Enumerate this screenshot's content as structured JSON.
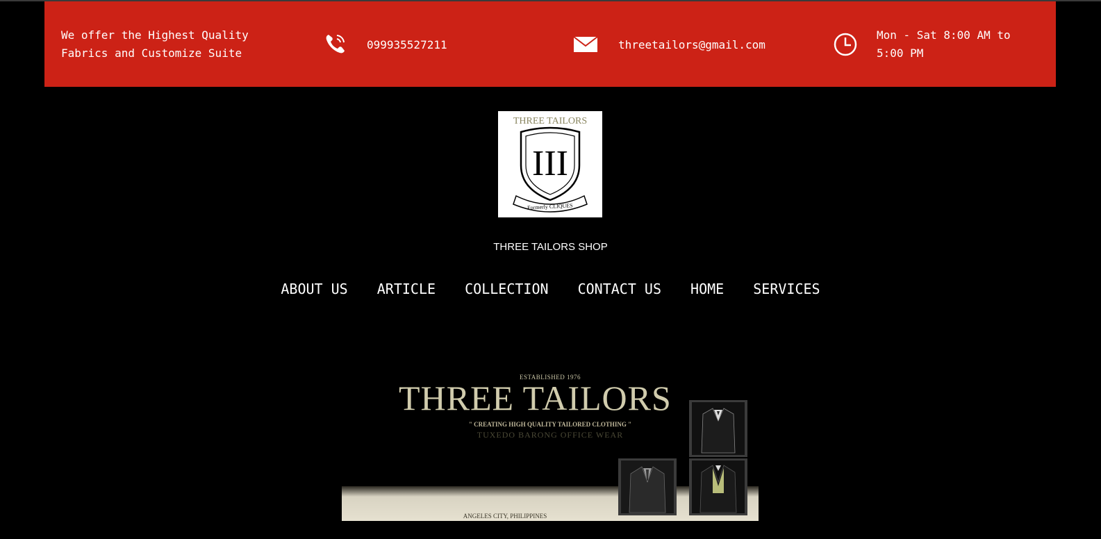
{
  "topbar": {
    "tagline": "We offer the Highest Quality Fabrics and Customize Suite",
    "phone": "099935527211",
    "email": "threetailors@gmail.com",
    "hours": "Mon - Sat 8:00 AM to 5:00 PM",
    "icons": [
      "phone-icon",
      "mail-icon",
      "clock-icon"
    ],
    "background_color": "#cc2216"
  },
  "logo": {
    "top_text": "THREE TAILORS",
    "emblem": "III",
    "ribbon_text": "Formerly CLIQUES"
  },
  "shop_name": "THREE TAILORS SHOP",
  "nav": {
    "items": [
      {
        "label": "ABOUT US"
      },
      {
        "label": "ARTICLE"
      },
      {
        "label": "COLLECTION"
      },
      {
        "label": "CONTACT US"
      },
      {
        "label": "HOME"
      },
      {
        "label": "SERVICES"
      }
    ]
  },
  "banner": {
    "established": "ESTABLISHED 1976",
    "title": "THREE TAILORS",
    "slogan": "\" CREATING HIGH QUALITY TAILORED CLOTHING \"",
    "categories": "TUXEDO   BARONG   OFFICE WEAR",
    "location": "ANGELES CITY, PHILIPPINES"
  }
}
